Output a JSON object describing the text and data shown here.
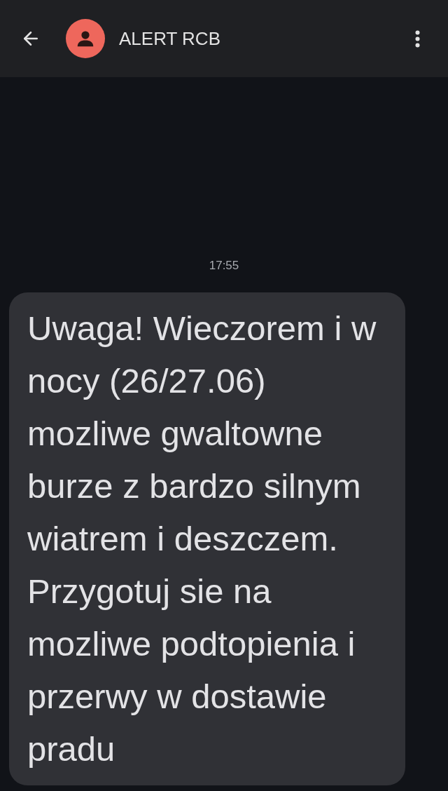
{
  "header": {
    "title": "ALERT RCB"
  },
  "timestamp": "17:55",
  "message": {
    "text": "Uwaga! Wieczorem i w nocy (26/27.06) mozliwe gwaltowne burze z bardzo silnym wiatrem i deszczem. Przygotuj sie na mozliwe podtopienia i przerwy w dostawie pradu"
  }
}
